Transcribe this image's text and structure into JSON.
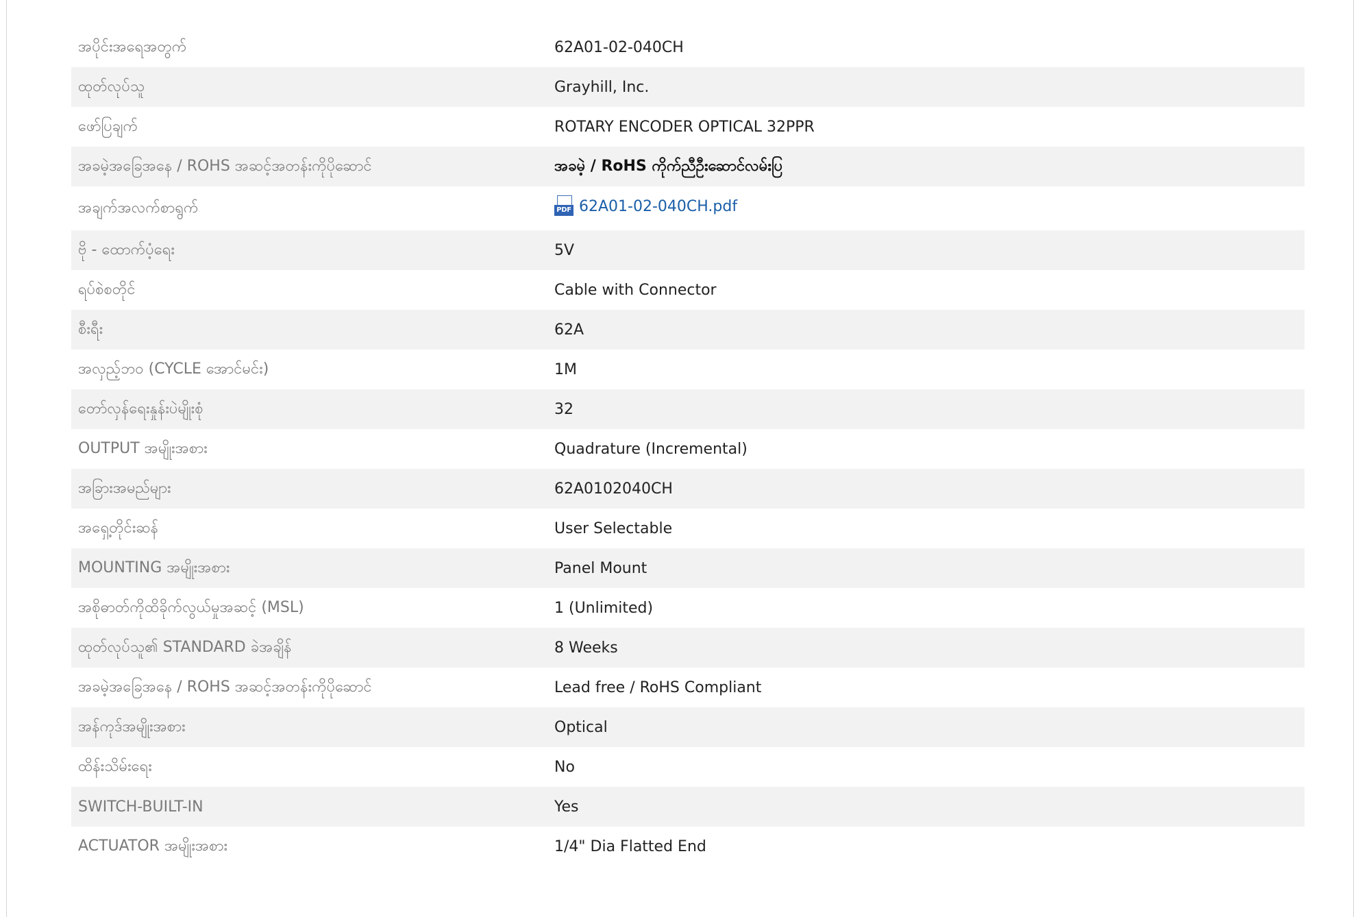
{
  "specs": [
    {
      "label": "အပိုင်းအရေအတွက်",
      "value": "62A01-02-040CH"
    },
    {
      "label": "ထုတ်လုပ်သူ",
      "value": "Grayhill, Inc."
    },
    {
      "label": "ဖော်ပြချက်",
      "value": "ROTARY ENCODER OPTICAL 32PPR"
    },
    {
      "label": "အခမဲ့အခြေအနေ / ROHS အဆင့်အတန်းကိုပိုဆောင်",
      "value": "အခမဲ့ / RoHS ကိုက်ညီဦးဆောင်လမ်းပြ"
    },
    {
      "label": "အချက်အလက်စာရွက်",
      "value": "62A01-02-040CH.pdf",
      "icon": "pdf-icon",
      "icon_text": "PDF"
    },
    {
      "label": "ဗို - ထောက်ပံ့ရေး",
      "value": "5V"
    },
    {
      "label": "ရပ်စဲစတိုင်",
      "value": "Cable with Connector"
    },
    {
      "label": "စီးရီး",
      "value": "62A"
    },
    {
      "label": "အလှည့်ဘဝ (CYCLE အောင်မင်း)",
      "value": "1M"
    },
    {
      "label": "တော်လှန်ရေးနှုန်းပဲမျိုးစုံ",
      "value": "32"
    },
    {
      "label": "OUTPUT အမျိုးအစား",
      "value": "Quadrature (Incremental)"
    },
    {
      "label": "အခြားအမည်များ",
      "value": "62A0102040CH"
    },
    {
      "label": "အရှေ့တိုင်းဆန်",
      "value": "User Selectable"
    },
    {
      "label": "MOUNTING အမျိုးအစား",
      "value": "Panel Mount"
    },
    {
      "label": "အစိုဓာတ်ကိုထိခိုက်လွယ်မှုအဆင့် (MSL)",
      "value": "1 (Unlimited)"
    },
    {
      "label": "ထုတ်လုပ်သူ၏ STANDARD ခဲအချိန်",
      "value": "8 Weeks"
    },
    {
      "label": "အခမဲ့အခြေအနေ / ROHS အဆင့်အတန်းကိုပိုဆောင်",
      "value": "Lead free / RoHS Compliant"
    },
    {
      "label": "အန်ကုဒ်အမျိုးအစား",
      "value": "Optical"
    },
    {
      "label": "ထိန်းသိမ်းရေး",
      "value": "No"
    },
    {
      "label": "SWITCH-BUILT-IN",
      "value": "Yes"
    },
    {
      "label": "ACTUATOR အမျိုးအစား",
      "value": "1/4\" Dia Flatted End"
    }
  ],
  "colors": {
    "label_text": "#7a7a7a",
    "value_text": "#222222",
    "row_stripe": "#f2f2f2",
    "link": "#1a5ea8",
    "pdf_icon": "#2f63b4"
  }
}
